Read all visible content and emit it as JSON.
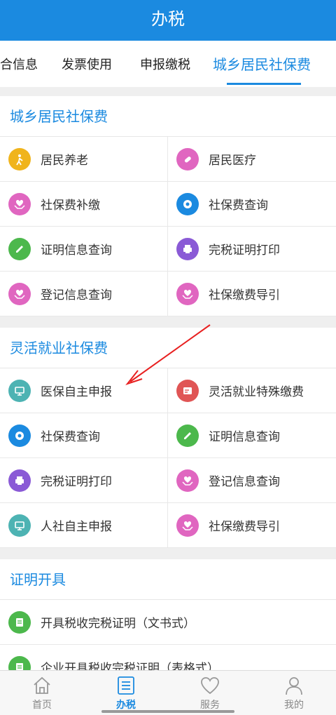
{
  "header": {
    "title": "办税"
  },
  "tabs": [
    {
      "label": "合信息"
    },
    {
      "label": "发票使用"
    },
    {
      "label": "申报缴税"
    },
    {
      "label": "城乡居民社保费"
    }
  ],
  "sections": [
    {
      "title": "城乡居民社保费",
      "items": [
        {
          "label": "居民养老",
          "icon": "elderly-icon",
          "color": "#f0b41c"
        },
        {
          "label": "居民医疗",
          "icon": "medicine-icon",
          "color": "#e066c0"
        },
        {
          "label": "社保费补缴",
          "icon": "hands-heart-icon",
          "color": "#e066c0"
        },
        {
          "label": "社保费查询",
          "icon": "query-icon",
          "color": "#1b8ae0"
        },
        {
          "label": "证明信息查询",
          "icon": "pen-icon",
          "color": "#4cb84c"
        },
        {
          "label": "完税证明打印",
          "icon": "printer-icon",
          "color": "#8a5ad6"
        },
        {
          "label": "登记信息查询",
          "icon": "hands-heart-icon",
          "color": "#e066c0"
        },
        {
          "label": "社保缴费导引",
          "icon": "hands-heart-icon",
          "color": "#e066c0"
        }
      ]
    },
    {
      "title": "灵活就业社保费",
      "items": [
        {
          "label": "医保自主申报",
          "icon": "monitor-icon",
          "color": "#4db3b3"
        },
        {
          "label": "灵活就业特殊缴费",
          "icon": "card-icon",
          "color": "#e05555"
        },
        {
          "label": "社保费查询",
          "icon": "query-icon",
          "color": "#1b8ae0"
        },
        {
          "label": "证明信息查询",
          "icon": "pen-icon",
          "color": "#4cb84c"
        },
        {
          "label": "完税证明打印",
          "icon": "printer-icon",
          "color": "#8a5ad6"
        },
        {
          "label": "登记信息查询",
          "icon": "hands-heart-icon",
          "color": "#e066c0"
        },
        {
          "label": "人社自主申报",
          "icon": "monitor-icon",
          "color": "#4db3b3"
        },
        {
          "label": "社保缴费导引",
          "icon": "hands-heart-icon",
          "color": "#e066c0"
        }
      ]
    },
    {
      "title": "证明开具",
      "items": [
        {
          "label": "开具税收完税证明（文书式）",
          "icon": "document-icon",
          "color": "#4cb84c"
        },
        {
          "label": "企业开具税收完税证明（表格式）",
          "icon": "document-icon",
          "color": "#4cb84c"
        }
      ]
    }
  ],
  "bottom_nav": [
    {
      "label": "首页",
      "icon": "home-icon"
    },
    {
      "label": "办税",
      "icon": "list-icon"
    },
    {
      "label": "服务",
      "icon": "heart-icon"
    },
    {
      "label": "我的",
      "icon": "person-icon"
    }
  ],
  "colors": {
    "brand": "#1b8ae0",
    "annotation": "#e82020"
  }
}
